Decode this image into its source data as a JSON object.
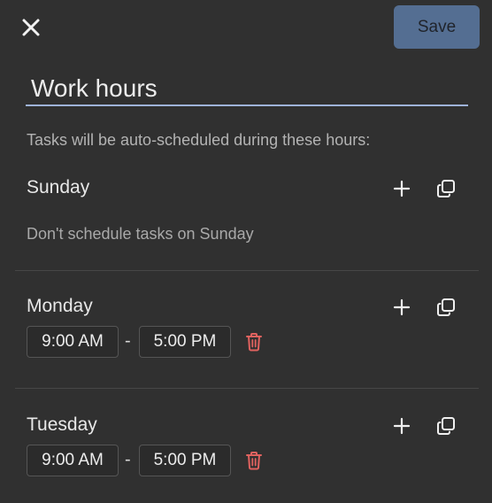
{
  "header": {
    "close_icon": "close-icon",
    "save_label": "Save"
  },
  "form": {
    "title_value": "Work hours",
    "subtitle": "Tasks will be auto-scheduled during these hours:"
  },
  "days": [
    {
      "name": "Sunday",
      "empty_note": "Don't schedule tasks on Sunday"
    },
    {
      "name": "Monday",
      "start": "9:00 AM",
      "separator": "-",
      "end": "5:00 PM"
    },
    {
      "name": "Tuesday",
      "start": "9:00 AM",
      "separator": "-",
      "end": "5:00 PM"
    }
  ],
  "icons": {
    "add": "plus-icon",
    "copy": "copy-icon",
    "delete": "trash-icon"
  },
  "colors": {
    "accent": "#546e92",
    "underline": "#9fb3d9",
    "delete": "#e0625f",
    "background": "#303030"
  }
}
